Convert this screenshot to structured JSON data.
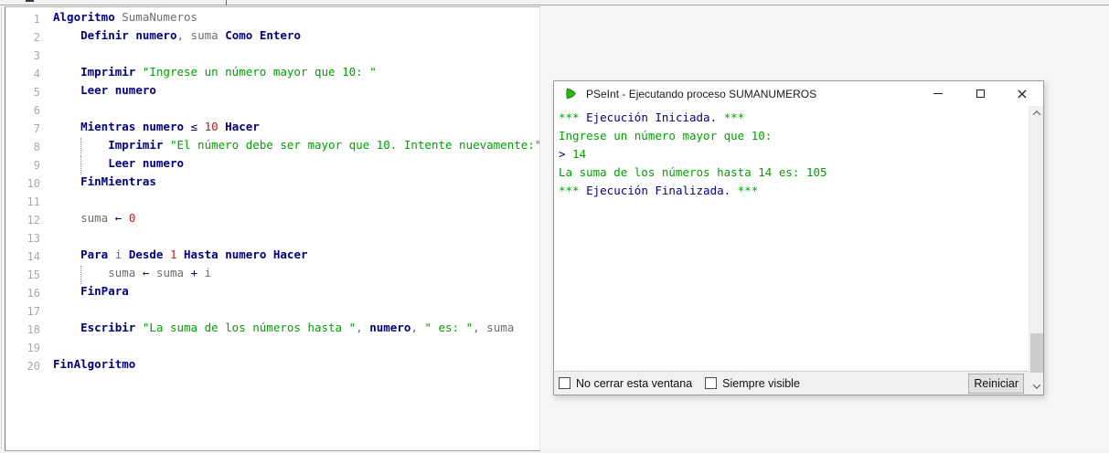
{
  "colors": {
    "keyword": "#000080",
    "identifier": "#6e6e6e",
    "string": "#00a000",
    "number": "#b22222",
    "line_number": "#a8a8a8",
    "console_green": "#00a000",
    "console_blue": "#000080",
    "window_border": "#9b9b9b",
    "logo_green": "#33b41e"
  },
  "editor": {
    "lines": [
      {
        "n": 1,
        "indent": 0,
        "segments": [
          {
            "c": "kw",
            "t": "Algoritmo"
          },
          {
            "c": "id",
            "t": " SumaNumeros"
          }
        ]
      },
      {
        "n": 2,
        "indent": 1,
        "segments": [
          {
            "c": "kw",
            "t": "Definir "
          },
          {
            "c": "kw",
            "t": "numero"
          },
          {
            "c": "id",
            "t": ", "
          },
          {
            "c": "id",
            "t": "suma "
          },
          {
            "c": "kw",
            "t": "Como Entero"
          }
        ]
      },
      {
        "n": 3,
        "indent": 0,
        "segments": []
      },
      {
        "n": 4,
        "indent": 1,
        "segments": [
          {
            "c": "kw",
            "t": "Imprimir "
          },
          {
            "c": "str",
            "t": "\"Ingrese un número mayor que 10: \""
          }
        ]
      },
      {
        "n": 5,
        "indent": 1,
        "segments": [
          {
            "c": "kw",
            "t": "Leer "
          },
          {
            "c": "kw",
            "t": "numero"
          }
        ]
      },
      {
        "n": 6,
        "indent": 0,
        "segments": []
      },
      {
        "n": 7,
        "indent": 1,
        "segments": [
          {
            "c": "kw",
            "t": "Mientras "
          },
          {
            "c": "kw",
            "t": "numero "
          },
          {
            "c": "op",
            "t": "≤ "
          },
          {
            "c": "num",
            "t": "10 "
          },
          {
            "c": "kw",
            "t": "Hacer"
          }
        ]
      },
      {
        "n": 8,
        "indent": 2,
        "guide": true,
        "segments": [
          {
            "c": "kw",
            "t": "Imprimir "
          },
          {
            "c": "str",
            "t": "\"El número debe ser mayor que 10. Intente nuevamente:\""
          }
        ]
      },
      {
        "n": 9,
        "indent": 2,
        "guide": true,
        "segments": [
          {
            "c": "kw",
            "t": "Leer "
          },
          {
            "c": "kw",
            "t": "numero"
          }
        ]
      },
      {
        "n": 10,
        "indent": 1,
        "segments": [
          {
            "c": "kw",
            "t": "FinMientras"
          }
        ]
      },
      {
        "n": 11,
        "indent": 0,
        "segments": []
      },
      {
        "n": 12,
        "indent": 1,
        "segments": [
          {
            "c": "id",
            "t": "suma "
          },
          {
            "c": "op",
            "t": "← "
          },
          {
            "c": "num",
            "t": "0"
          }
        ]
      },
      {
        "n": 13,
        "indent": 0,
        "segments": []
      },
      {
        "n": 14,
        "indent": 1,
        "segments": [
          {
            "c": "kw",
            "t": "Para "
          },
          {
            "c": "id",
            "t": "i "
          },
          {
            "c": "kw",
            "t": "Desde "
          },
          {
            "c": "num",
            "t": "1 "
          },
          {
            "c": "kw",
            "t": "Hasta "
          },
          {
            "c": "kw",
            "t": "numero "
          },
          {
            "c": "kw",
            "t": "Hacer"
          }
        ]
      },
      {
        "n": 15,
        "indent": 2,
        "guide": true,
        "segments": [
          {
            "c": "id",
            "t": "suma "
          },
          {
            "c": "op",
            "t": "← "
          },
          {
            "c": "id",
            "t": "suma "
          },
          {
            "c": "op",
            "t": "+ "
          },
          {
            "c": "id",
            "t": "i"
          }
        ]
      },
      {
        "n": 16,
        "indent": 1,
        "segments": [
          {
            "c": "kw",
            "t": "FinPara"
          }
        ]
      },
      {
        "n": 17,
        "indent": 0,
        "segments": []
      },
      {
        "n": 18,
        "indent": 1,
        "segments": [
          {
            "c": "kw",
            "t": "Escribir "
          },
          {
            "c": "str",
            "t": "\"La suma de los números hasta \""
          },
          {
            "c": "id",
            "t": ", "
          },
          {
            "c": "kw",
            "t": "numero"
          },
          {
            "c": "id",
            "t": ", "
          },
          {
            "c": "str",
            "t": "\" es: \""
          },
          {
            "c": "id",
            "t": ", "
          },
          {
            "c": "id",
            "t": "suma"
          }
        ]
      },
      {
        "n": 19,
        "indent": 0,
        "segments": []
      },
      {
        "n": 20,
        "indent": 0,
        "segments": [
          {
            "c": "kw",
            "t": "FinAlgoritmo"
          }
        ]
      }
    ]
  },
  "console_window": {
    "title": "PSeInt - Ejecutando proceso SUMANUMEROS",
    "icon": "pseint-logo",
    "output_lines": [
      [
        {
          "c": "g",
          "t": "*** "
        },
        {
          "c": "b",
          "t": "Ejecución Iniciada."
        },
        {
          "c": "g",
          "t": " ***"
        }
      ],
      [
        {
          "c": "g",
          "t": "Ingrese un número mayor que 10:"
        }
      ],
      [
        {
          "c": "b",
          "t": ">"
        },
        {
          "c": "g",
          "t": " 14"
        }
      ],
      [
        {
          "c": "g",
          "t": "La suma de los números hasta 14 es: 105"
        }
      ],
      [
        {
          "c": "g",
          "t": "*** "
        },
        {
          "c": "b",
          "t": "Ejecución Finalizada."
        },
        {
          "c": "g",
          "t": " ***"
        }
      ]
    ],
    "footer": {
      "checkbox_no_cerrar": "No cerrar esta ventana",
      "checkbox_siempre_visible": "Siempre visible",
      "restart_label": "Reiniciar"
    }
  }
}
